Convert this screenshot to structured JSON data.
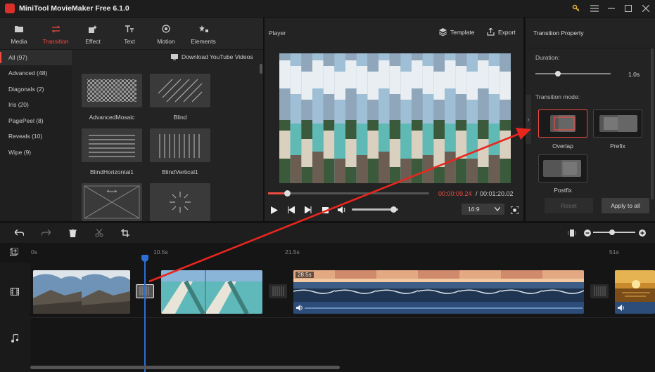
{
  "app": {
    "title": "MiniTool MovieMaker Free 6.1.0"
  },
  "toolbar": {
    "items": [
      {
        "label": "Media",
        "icon": "folder-icon"
      },
      {
        "label": "Transition",
        "icon": "transition-icon"
      },
      {
        "label": "Effect",
        "icon": "effect-icon"
      },
      {
        "label": "Text",
        "icon": "text-icon"
      },
      {
        "label": "Motion",
        "icon": "motion-icon"
      },
      {
        "label": "Elements",
        "icon": "elements-icon"
      }
    ]
  },
  "categories": [
    "All (97)",
    "Advanced (48)",
    "Diagonals (2)",
    "Iris (20)",
    "PagePeel (8)",
    "Reveals (10)",
    "Wipe (9)"
  ],
  "download_label": "Download YouTube Videos",
  "transitions": [
    "AdvancedMosaic",
    "Blind",
    "BlindHorizontal1",
    "BlindVertical1",
    "",
    ""
  ],
  "player": {
    "title": "Player",
    "template_label": "Template",
    "export_label": "Export",
    "time_current": "00:00:09.24",
    "time_total": "00:01:20.02",
    "aspect_ratio": "16:9",
    "progress": 0.12,
    "volume": 0.9
  },
  "property": {
    "title": "Transition Property",
    "duration_label": "Duration:",
    "duration_value": "1.0s",
    "duration_level": 0.3,
    "mode_label": "Transition mode:",
    "modes": [
      "Overlap",
      "Prefix",
      "Postfix"
    ],
    "reset_label": "Reset",
    "apply_label": "Apply to all"
  },
  "timeline": {
    "ticks": [
      "0s",
      "10.5s",
      "21.5s",
      "51s"
    ],
    "clip_duration": "28.5s",
    "zoom_level": 0.45
  }
}
